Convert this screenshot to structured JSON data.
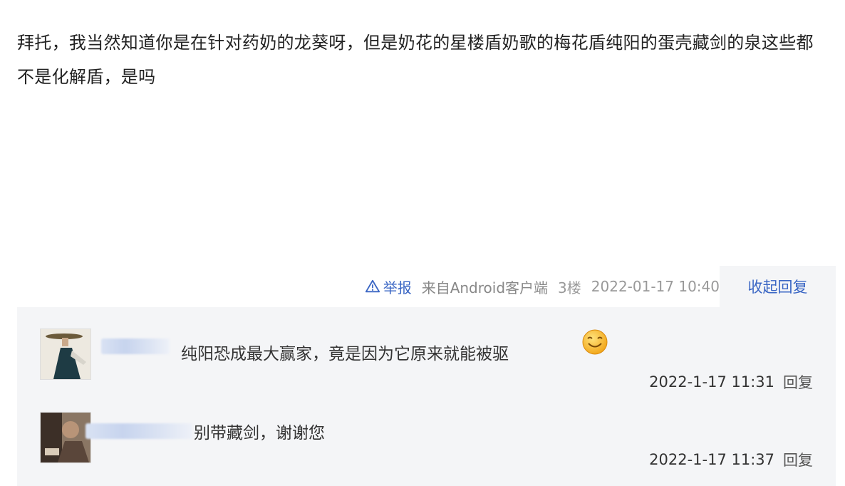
{
  "post": {
    "text": "拜托，我当然知道你是在针对药奶的龙葵呀，但是奶花的星楼盾奶歌的梅花盾纯阳的蛋壳藏剑的泉这些都不是化解盾，是吗"
  },
  "meta": {
    "report_label": "举报",
    "client_label": "来自Android客户端",
    "floor_label": "3楼",
    "time": "2022-01-17 10:40",
    "collapse_label": "收起回复"
  },
  "replies": [
    {
      "text": "纯阳恐成最大赢家，竟是因为它原来就能被驱",
      "time": "2022-1-17 11:31",
      "reply_label": "回复",
      "icons": [
        "avatar-figure",
        "smiley-emoji"
      ]
    },
    {
      "text": "别带藏剑，谢谢您",
      "time": "2022-1-17 11:37",
      "reply_label": "回复",
      "icons": [
        "avatar-photo"
      ]
    }
  ],
  "colors": {
    "link": "#3a66c4",
    "panel_bg": "#f4f5f7",
    "meta_text": "#999999"
  }
}
